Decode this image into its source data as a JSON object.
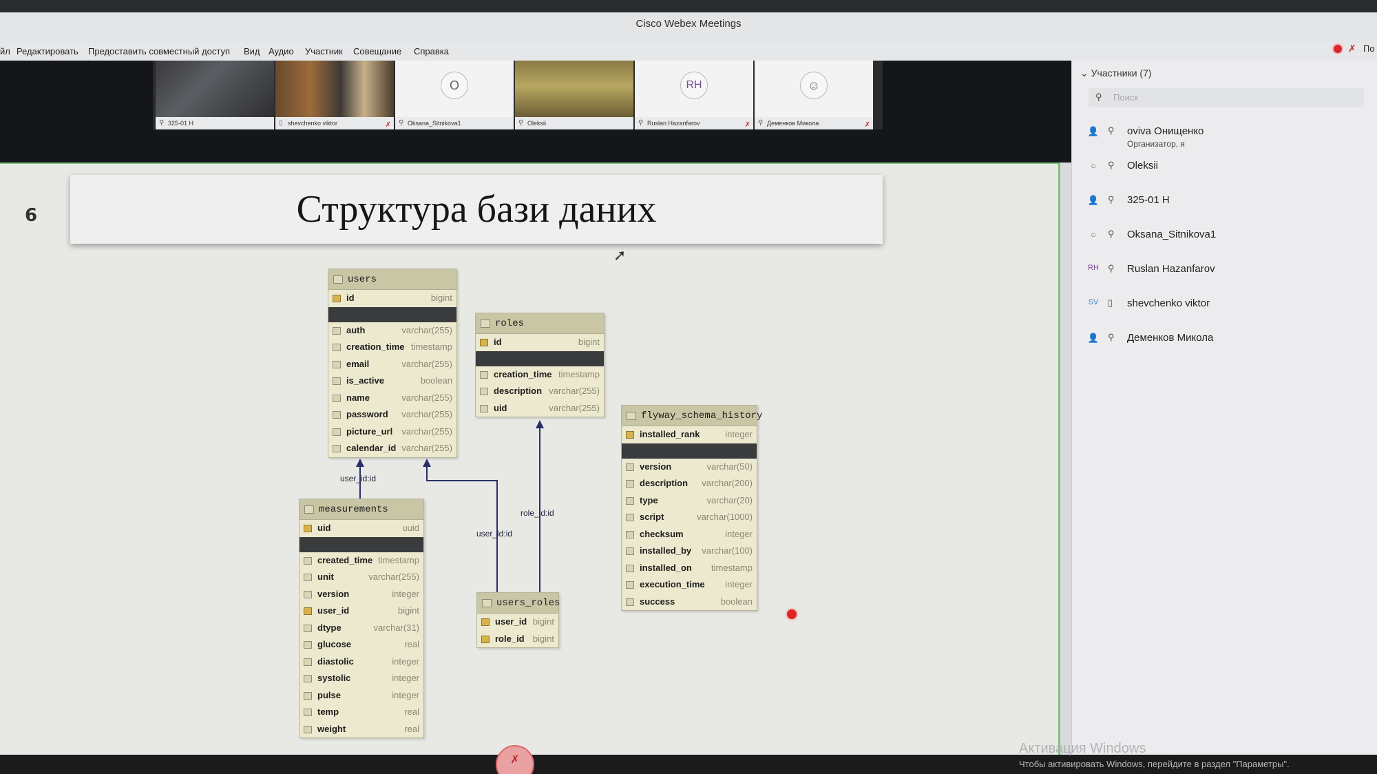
{
  "window": {
    "title": "Cisco Webex Meetings"
  },
  "menu": {
    "items": [
      "йл",
      "Редактировать",
      "Предоставить совместный доступ",
      "Вид",
      "Аудио",
      "Участник",
      "Совещание",
      "Справка"
    ],
    "right_text": "По"
  },
  "video_tiles": [
    {
      "name": "325-01 Н",
      "type": "camera",
      "muted": false,
      "active": false
    },
    {
      "name": "shevchenko viktor",
      "type": "camera",
      "muted": true,
      "active": false
    },
    {
      "name": "Oksana_Sitnikova1",
      "type": "avatar",
      "initials": "O",
      "muted": false,
      "active": false
    },
    {
      "name": "Oleksii",
      "type": "camera",
      "muted": false,
      "active": true
    },
    {
      "name": "Ruslan Hazanfarov",
      "type": "avatar",
      "initials": "RH",
      "muted": true,
      "active": false
    },
    {
      "name": "Деменков Микола",
      "type": "avatar",
      "initials": "",
      "muted": true,
      "active": false
    }
  ],
  "participants_panel": {
    "header": "Участники (7)",
    "search_placeholder": "Поиск",
    "items": [
      {
        "icon": "person-icon",
        "name": "oviva Онищенко",
        "role": "Организатор, я"
      },
      {
        "icon": "circle-icon",
        "name": "Oleksii",
        "role": ""
      },
      {
        "icon": "person-icon",
        "name": "325-01 Н",
        "role": ""
      },
      {
        "icon": "circle-icon",
        "name": "Oksana_Sitnikova1",
        "role": ""
      },
      {
        "icon": "RH",
        "name": "Ruslan Hazanfarov",
        "role": ""
      },
      {
        "icon": "SV",
        "name": "shevchenko viktor",
        "role": ""
      },
      {
        "icon": "person-icon",
        "name": "Деменков Микола",
        "role": ""
      }
    ]
  },
  "slide": {
    "number": "6",
    "title": "Структура бази даних"
  },
  "tables": {
    "users": {
      "name": "users",
      "pk": [
        [
          "id",
          "bigint"
        ]
      ],
      "cols": [
        [
          "auth",
          "varchar(255)"
        ],
        [
          "creation_time",
          "timestamp"
        ],
        [
          "email",
          "varchar(255)"
        ],
        [
          "is_active",
          "boolean"
        ],
        [
          "name",
          "varchar(255)"
        ],
        [
          "password",
          "varchar(255)"
        ],
        [
          "picture_url",
          "varchar(255)"
        ],
        [
          "calendar_id",
          "varchar(255)"
        ]
      ]
    },
    "roles": {
      "name": "roles",
      "pk": [
        [
          "id",
          "bigint"
        ]
      ],
      "cols": [
        [
          "creation_time",
          "timestamp"
        ],
        [
          "description",
          "varchar(255)"
        ],
        [
          "uid",
          "varchar(255)"
        ]
      ]
    },
    "flyway": {
      "name": "flyway_schema_history",
      "pk": [
        [
          "installed_rank",
          "integer"
        ]
      ],
      "cols": [
        [
          "version",
          "varchar(50)"
        ],
        [
          "description",
          "varchar(200)"
        ],
        [
          "type",
          "varchar(20)"
        ],
        [
          "script",
          "varchar(1000)"
        ],
        [
          "checksum",
          "integer"
        ],
        [
          "installed_by",
          "varchar(100)"
        ],
        [
          "installed_on",
          "timestamp"
        ],
        [
          "execution_time",
          "integer"
        ],
        [
          "success",
          "boolean"
        ]
      ]
    },
    "measurements": {
      "name": "measurements",
      "pk": [
        [
          "uid",
          "uuid"
        ]
      ],
      "cols": [
        [
          "created_time",
          "timestamp"
        ],
        [
          "unit",
          "varchar(255)"
        ],
        [
          "version",
          "integer"
        ],
        [
          "user_id",
          "bigint"
        ],
        [
          "dtype",
          "varchar(31)"
        ],
        [
          "glucose",
          "real"
        ],
        [
          "diastolic",
          "integer"
        ],
        [
          "systolic",
          "integer"
        ],
        [
          "pulse",
          "integer"
        ],
        [
          "temp",
          "real"
        ],
        [
          "weight",
          "real"
        ]
      ]
    },
    "users_roles": {
      "name": "users_roles",
      "cols": [
        [
          "user_id",
          "bigint"
        ],
        [
          "role_id",
          "bigint"
        ]
      ]
    }
  },
  "relations": {
    "meas_users": "user_id:id",
    "ur_users": "user_id:id",
    "ur_roles": "role_id:id"
  },
  "watermark": {
    "line1": "Активация Windows",
    "line2": "Чтобы активировать Windows, перейдите в раздел \"Параметры\"."
  }
}
